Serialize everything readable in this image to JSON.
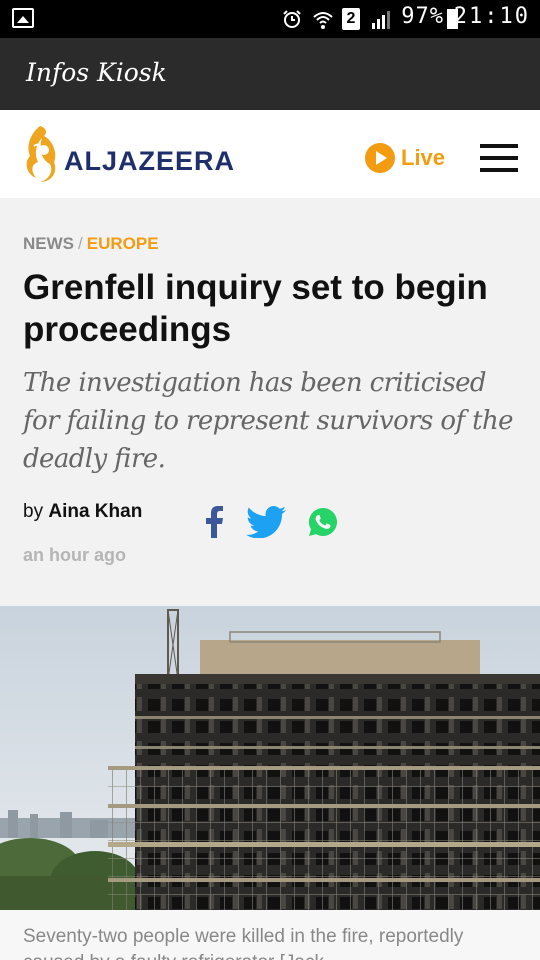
{
  "status_bar": {
    "battery_percent": "97%",
    "time": "21:10",
    "sim_label": "2",
    "icons": [
      "gallery-icon",
      "alarm-icon",
      "wifi-icon",
      "sim-icon",
      "signal-icon",
      "battery-icon"
    ]
  },
  "app_bar": {
    "title": "Infos Kiosk"
  },
  "site_header": {
    "logo_text": "ALJAZEERA",
    "live_label": "Live",
    "colors": {
      "brand_navy": "#1f2f6b",
      "accent_orange": "#f39c12"
    }
  },
  "article": {
    "breadcrumb": {
      "section": "NEWS",
      "separator": "/",
      "category": "EUROPE"
    },
    "headline": "Grenfell inquiry set to begin proceedings",
    "dek": "The investigation has been criticised for failing to represent survivors of the deadly fire.",
    "byline_prefix": "by",
    "author": "Aina Khan",
    "timestamp": "an hour ago",
    "share_icons": [
      "facebook-icon",
      "twitter-icon",
      "whatsapp-icon"
    ],
    "image_caption": "Seventy-two people were killed in the fire, reportedly caused by a faulty refrigerator [Jack"
  }
}
